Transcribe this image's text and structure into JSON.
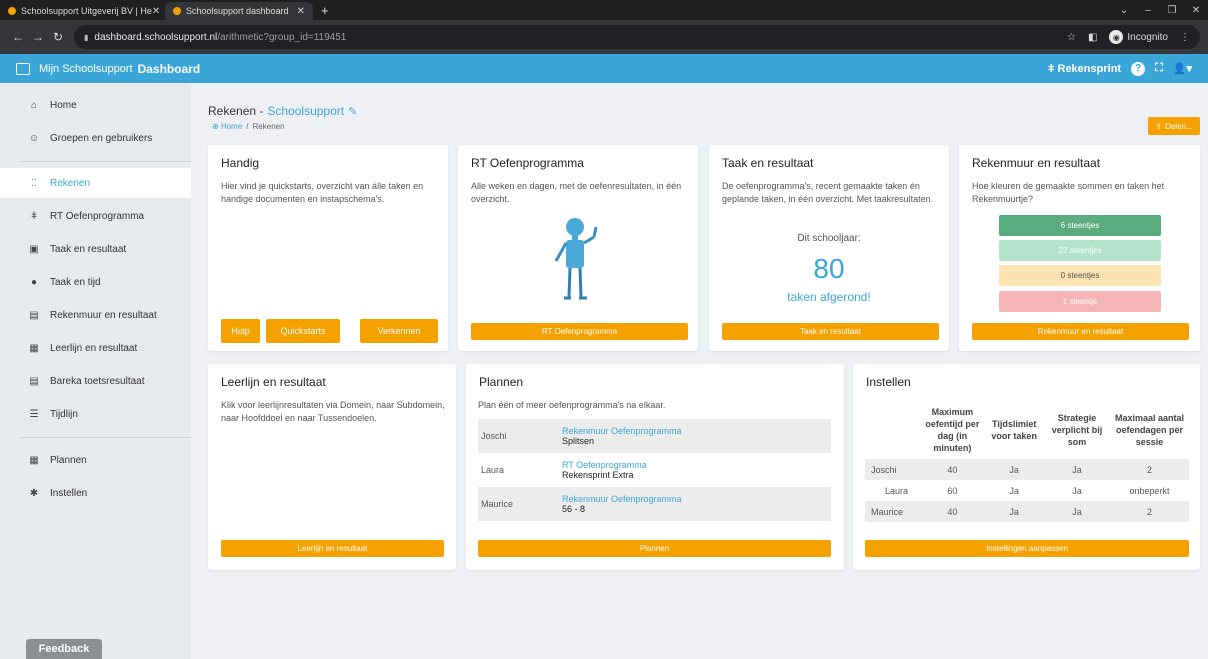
{
  "browser": {
    "tabs": [
      {
        "title": "Schoolsupport Uitgeverij BV | He",
        "close": "✕"
      },
      {
        "title": "Schoolsupport dashboard",
        "close": "✕"
      }
    ],
    "new_tab": "+",
    "url_host": "dashboard.schoolsupport.nl",
    "url_path": "/arithmetic?group_id=119451",
    "incognito": "Incognito"
  },
  "header": {
    "brand_prefix": "Mijn Schoolsupport",
    "brand_bold": "Dashboard",
    "program": "Rekensprint"
  },
  "sidebar": {
    "items": [
      {
        "label": "Home",
        "icon": "home-icon",
        "glyph": "⌂"
      },
      {
        "label": "Groepen en gebruikers",
        "icon": "users-icon",
        "glyph": "☺"
      },
      {
        "label": "Rekenen",
        "icon": "grid-icon",
        "glyph": "⁚⁚"
      },
      {
        "label": "RT Oefenprogramma",
        "icon": "person-icon",
        "glyph": "ǂ"
      },
      {
        "label": "Taak en resultaat",
        "icon": "task-icon",
        "glyph": "▣"
      },
      {
        "label": "Taak en tijd",
        "icon": "stopwatch-icon",
        "glyph": "●"
      },
      {
        "label": "Rekenmuur en resultaat",
        "icon": "wall-icon",
        "glyph": "▤"
      },
      {
        "label": "Leerlijn en resultaat",
        "icon": "calendar-icon",
        "glyph": "▦"
      },
      {
        "label": "Bareka toetsresultaat",
        "icon": "list-icon",
        "glyph": "▤"
      },
      {
        "label": "Tijdlijn",
        "icon": "timeline-icon",
        "glyph": "☰"
      },
      {
        "label": "Plannen",
        "icon": "planner-icon",
        "glyph": "▦"
      },
      {
        "label": "Instellen",
        "icon": "settings-icon",
        "glyph": "✱"
      }
    ],
    "feedback": "Feedback"
  },
  "page": {
    "title_prefix": "Rekenen -",
    "title_link": "Schoolsupport",
    "crumb_home": "Home",
    "crumb_sep": "/",
    "crumb_current": "Rekenen",
    "share_label": "Delen..."
  },
  "cards": {
    "handig": {
      "title": "Handig",
      "desc": "Hier vind je quickstarts, overzicht van álle taken en handige documenten en instapschema's.",
      "buttons": [
        "Hulp",
        "Quickstarts",
        "Verkennen"
      ]
    },
    "rt": {
      "title": "RT Oefenprogramma",
      "desc": "Alle weken en dagen, met de oefenresultaten, in één overzicht.",
      "button": "RT Oefenprogramma"
    },
    "taak": {
      "title": "Taak en resultaat",
      "desc": "De oefenprogramma's, recent gemaakte taken én geplande taken, in één overzicht. Met taakresultaten.",
      "year_label": "Dit schooljaar:",
      "count": "80",
      "count_label": "taken afgerond!",
      "button": "Taak en resultaat"
    },
    "rekenmuur": {
      "title": "Rekenmuur en resultaat",
      "desc": "Hoe kleuren de gemaakte sommen en taken het Rekenmuurtje?",
      "bricks": [
        {
          "label": "6 steentjes",
          "color": "#5aac7c"
        },
        {
          "label": "22 steentjes",
          "color": "#b4e3cc"
        },
        {
          "label": "0 steentjes",
          "color": "#fbe3b2"
        },
        {
          "label": "1 steentje",
          "color": "#f5b5b5"
        }
      ],
      "button": "Rekenmuur en resultaat"
    },
    "leerlijn": {
      "title": "Leerlijn en resultaat",
      "desc": "Klik voor leerlijnresultaten via Domein, naar Subdomein, naar Hoofddoel en naar Tussendoelen.",
      "button": "Leerlijn en resultaat"
    },
    "plannen": {
      "title": "Plannen",
      "desc": "Plan één of meer oefenprogramma's na elkaar.",
      "rows": [
        {
          "name": "Joschi",
          "program": "Rekenmuur Oefenprogramma",
          "detail": "Splitsen"
        },
        {
          "name": "Laura",
          "program": "RT Oefenprogramma",
          "detail": "Rekensprint Extra"
        },
        {
          "name": "Maurice",
          "program": "Rekenmuur Oefenprogramma",
          "detail": "56 - 8"
        }
      ],
      "button": "Plannen"
    },
    "instellen": {
      "title": "Instellen",
      "headers": [
        "",
        "Maximum oefentijd per dag (in minuten)",
        "Tijdslimiet voor taken",
        "Strategie verplicht bij som",
        "Maximaal aantal oefendagen per sessie"
      ],
      "rows": [
        [
          "Joschi",
          "40",
          "Ja",
          "Ja",
          "2"
        ],
        [
          "Laura",
          "60",
          "Ja",
          "Ja",
          "onbeperkt"
        ],
        [
          "Maurice",
          "40",
          "Ja",
          "Ja",
          "2"
        ]
      ],
      "button": "Instellingen aanpassen"
    }
  }
}
